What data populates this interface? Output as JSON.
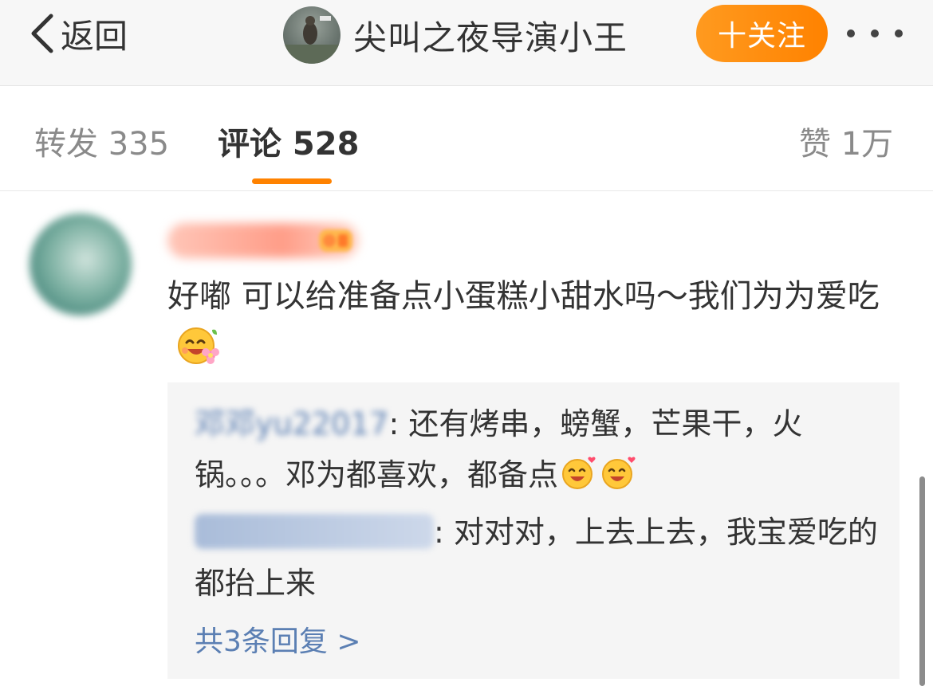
{
  "navbar": {
    "back_label": "返回",
    "title": "尖叫之夜导演小王",
    "follow_label": "十关注",
    "more_icon": "more-horizontal-icon",
    "avatar_icon": "user-avatar"
  },
  "tabs": {
    "repost": "转发 335",
    "comments": "评论 528",
    "likes": "赞 1万",
    "active": "comments",
    "accent_color": "#ff8200"
  },
  "comment": {
    "username": "",
    "text": "好嘟  可以给准备点小蛋糕小甜水吗～我们为为爱吃",
    "emoji": "happy-flower-emoji",
    "replies": [
      {
        "user": "邓邓yu22017",
        "sep": ": ",
        "text": "还有烤串，螃蟹，芒果干，火锅。。。邓为都喜欢，都备点",
        "emoji": "love-emoji"
      },
      {
        "user": "",
        "sep": ": ",
        "text": "对对对，上去上去，我宝爱吃的都抬上来"
      }
    ],
    "reply_count": "共3条回复 >",
    "link_color": "#5b7fb3"
  }
}
